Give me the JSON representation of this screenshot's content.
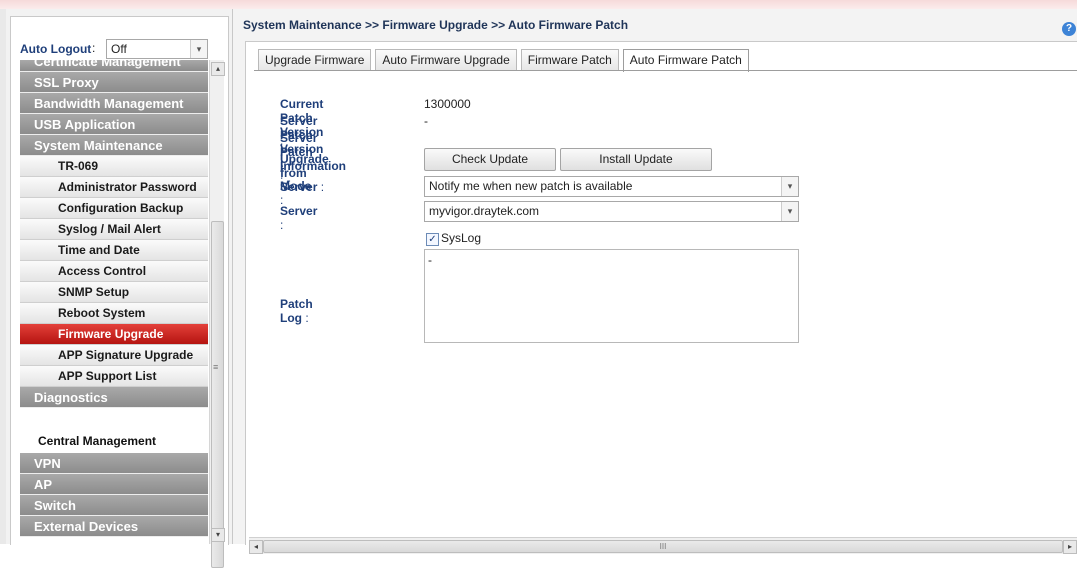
{
  "breadcrumb": "System Maintenance >> Firmware Upgrade >> Auto Firmware Patch",
  "help_icon": "?",
  "auto_logout": {
    "label": "Auto Logout",
    "sep": ":",
    "value": "Off",
    "arrow": "▾"
  },
  "sidebar": {
    "items": [
      {
        "type": "cat",
        "label": "Certificate Management",
        "cut": true
      },
      {
        "type": "cat",
        "label": "SSL Proxy"
      },
      {
        "type": "cat",
        "label": "Bandwidth Management"
      },
      {
        "type": "cat",
        "label": "USB Application"
      },
      {
        "type": "cat",
        "label": "System Maintenance"
      },
      {
        "type": "sub",
        "label": "TR-069"
      },
      {
        "type": "sub",
        "label": "Administrator Password"
      },
      {
        "type": "sub",
        "label": "Configuration Backup"
      },
      {
        "type": "sub",
        "label": "Syslog / Mail Alert"
      },
      {
        "type": "sub",
        "label": "Time and Date"
      },
      {
        "type": "sub",
        "label": "Access Control"
      },
      {
        "type": "sub",
        "label": "SNMP Setup"
      },
      {
        "type": "sub",
        "label": "Reboot System"
      },
      {
        "type": "sub",
        "label": "Firmware Upgrade",
        "active": true
      },
      {
        "type": "sub",
        "label": "APP Signature Upgrade"
      },
      {
        "type": "sub",
        "label": "APP Support List"
      },
      {
        "type": "cat",
        "label": "Diagnostics"
      },
      {
        "type": "plain",
        "label": "Central Management"
      },
      {
        "type": "cat",
        "label": "VPN"
      },
      {
        "type": "cat",
        "label": "AP"
      },
      {
        "type": "cat",
        "label": "Switch"
      },
      {
        "type": "cat",
        "label": "External Devices"
      }
    ]
  },
  "tabs": [
    "Upgrade Firmware",
    "Auto Firmware Upgrade",
    "Firmware Patch",
    "Auto Firmware Patch"
  ],
  "form": {
    "current_patch_label": "Current Patch Version",
    "current_patch_value": "1300000",
    "server_patch_version_label": "Server Patch Version :",
    "server_patch_version_value": "-",
    "server_patch_info_label": "Server Patch Information",
    "upgrade_label": "Upgrade from Server",
    "check_update": "Check Update",
    "install_update": "Install Update",
    "mode_label": "Mode",
    "mode_value": "Notify me when new patch is available",
    "server_label": "Server",
    "server_value": "myvigor.draytek.com",
    "syslog_label": "SysLog",
    "patch_log_label": "Patch Log",
    "patch_log_value": "-",
    "colon": ":",
    "colon_dash": ": -",
    "check_mark": "✓"
  },
  "scroll": {
    "up": "▴",
    "down": "▾",
    "left": "◂",
    "right": "▸",
    "grip": "III",
    "vgrip": "≡"
  }
}
